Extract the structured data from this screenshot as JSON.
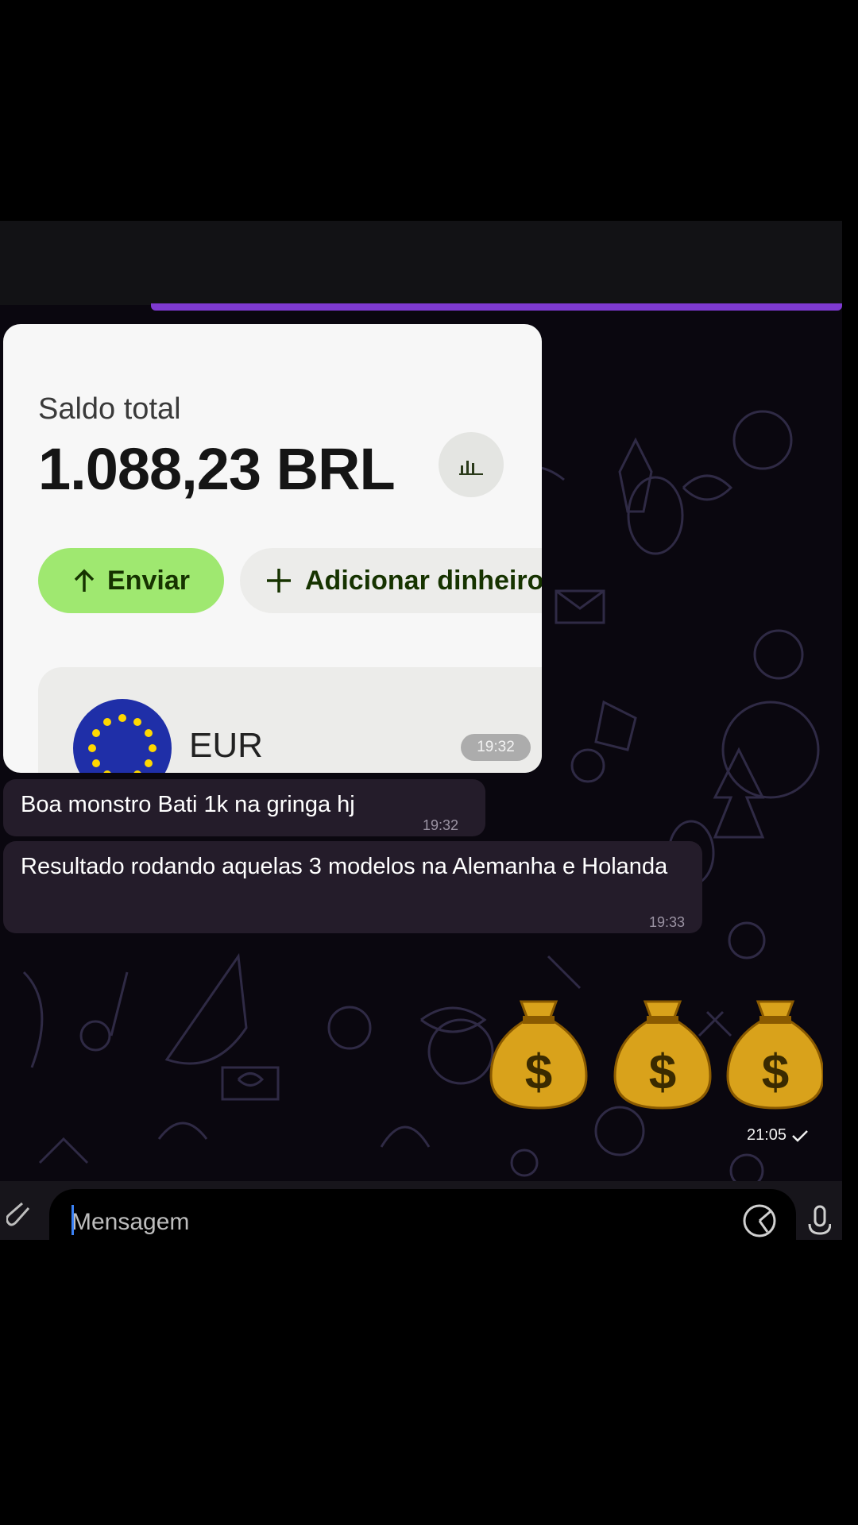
{
  "balance_card": {
    "label": "Saldo total",
    "amount": "1.088,23 BRL",
    "chart_button_icon": "bar-chart-icon",
    "send_label": "Enviar",
    "add_money_label": "Adicionar dinheiro",
    "currency": "EUR",
    "flag_icon": "eu-flag-icon"
  },
  "messages": [
    {
      "text": "",
      "time": "19:32",
      "type": "image"
    },
    {
      "text": "Boa monstro Bati 1k na gringa hj",
      "time": "19:32"
    },
    {
      "text": "Resultado rodando aquelas 3 modelos na Alemanha e Holanda",
      "time": "19:33"
    },
    {
      "text": "💰💰💰",
      "time": "21:05",
      "type": "sticker",
      "status": "read-check-icon"
    }
  ],
  "input": {
    "placeholder": "Mensagem"
  },
  "colors": {
    "chat_bg": "#0a070f",
    "bubble": "#241c2a",
    "accent_bar": "#7e3ad1",
    "send_green": "#9fe870",
    "send_text": "#163300"
  }
}
